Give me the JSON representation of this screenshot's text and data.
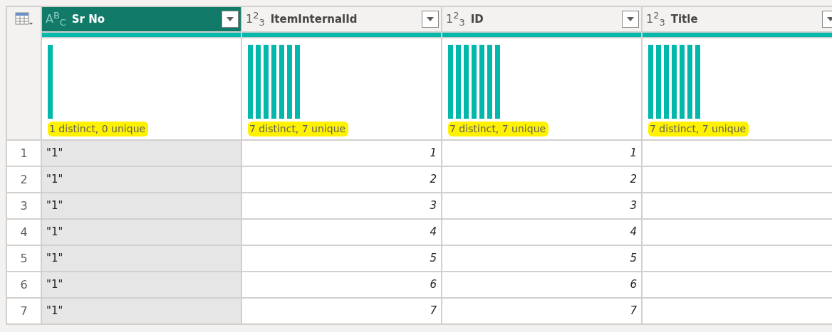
{
  "columns": [
    {
      "name": "Sr No",
      "kind": "text",
      "type_label": "A$^{B}$$_{C}$",
      "selected": true,
      "profile": {
        "kind": "single",
        "stats": "1 distinct, 0 unique",
        "highlighted": true
      }
    },
    {
      "name": "ItemInternalId",
      "kind": "number",
      "type_label": "1$^{2}$$_{3}$",
      "selected": false,
      "profile": {
        "kind": "even",
        "stats": "7 distinct, 7 unique",
        "highlighted": true
      }
    },
    {
      "name": "ID",
      "kind": "number",
      "type_label": "1$^{2}$$_{3}$",
      "selected": false,
      "profile": {
        "kind": "even",
        "stats": "7 distinct, 7 unique",
        "highlighted": true
      }
    },
    {
      "name": "Title",
      "kind": "number",
      "type_label": "1$^{2}$$_{3}$",
      "selected": false,
      "profile": {
        "kind": "even",
        "stats": "7 distinct, 7 unique",
        "highlighted": true
      }
    }
  ],
  "rows": [
    {
      "number": "1",
      "cells": [
        "\"1\"",
        "1",
        "1",
        null
      ]
    },
    {
      "number": "2",
      "cells": [
        "\"1\"",
        "2",
        "2",
        null
      ]
    },
    {
      "number": "3",
      "cells": [
        "\"1\"",
        "3",
        "3",
        null
      ]
    },
    {
      "number": "4",
      "cells": [
        "\"1\"",
        "4",
        "4",
        null
      ]
    },
    {
      "number": "5",
      "cells": [
        "\"1\"",
        "5",
        "5",
        null
      ]
    },
    {
      "number": "6",
      "cells": [
        "\"1\"",
        "6",
        "6",
        null
      ]
    },
    {
      "number": "7",
      "cells": [
        "\"1\"",
        "7",
        "7",
        null
      ]
    }
  ]
}
